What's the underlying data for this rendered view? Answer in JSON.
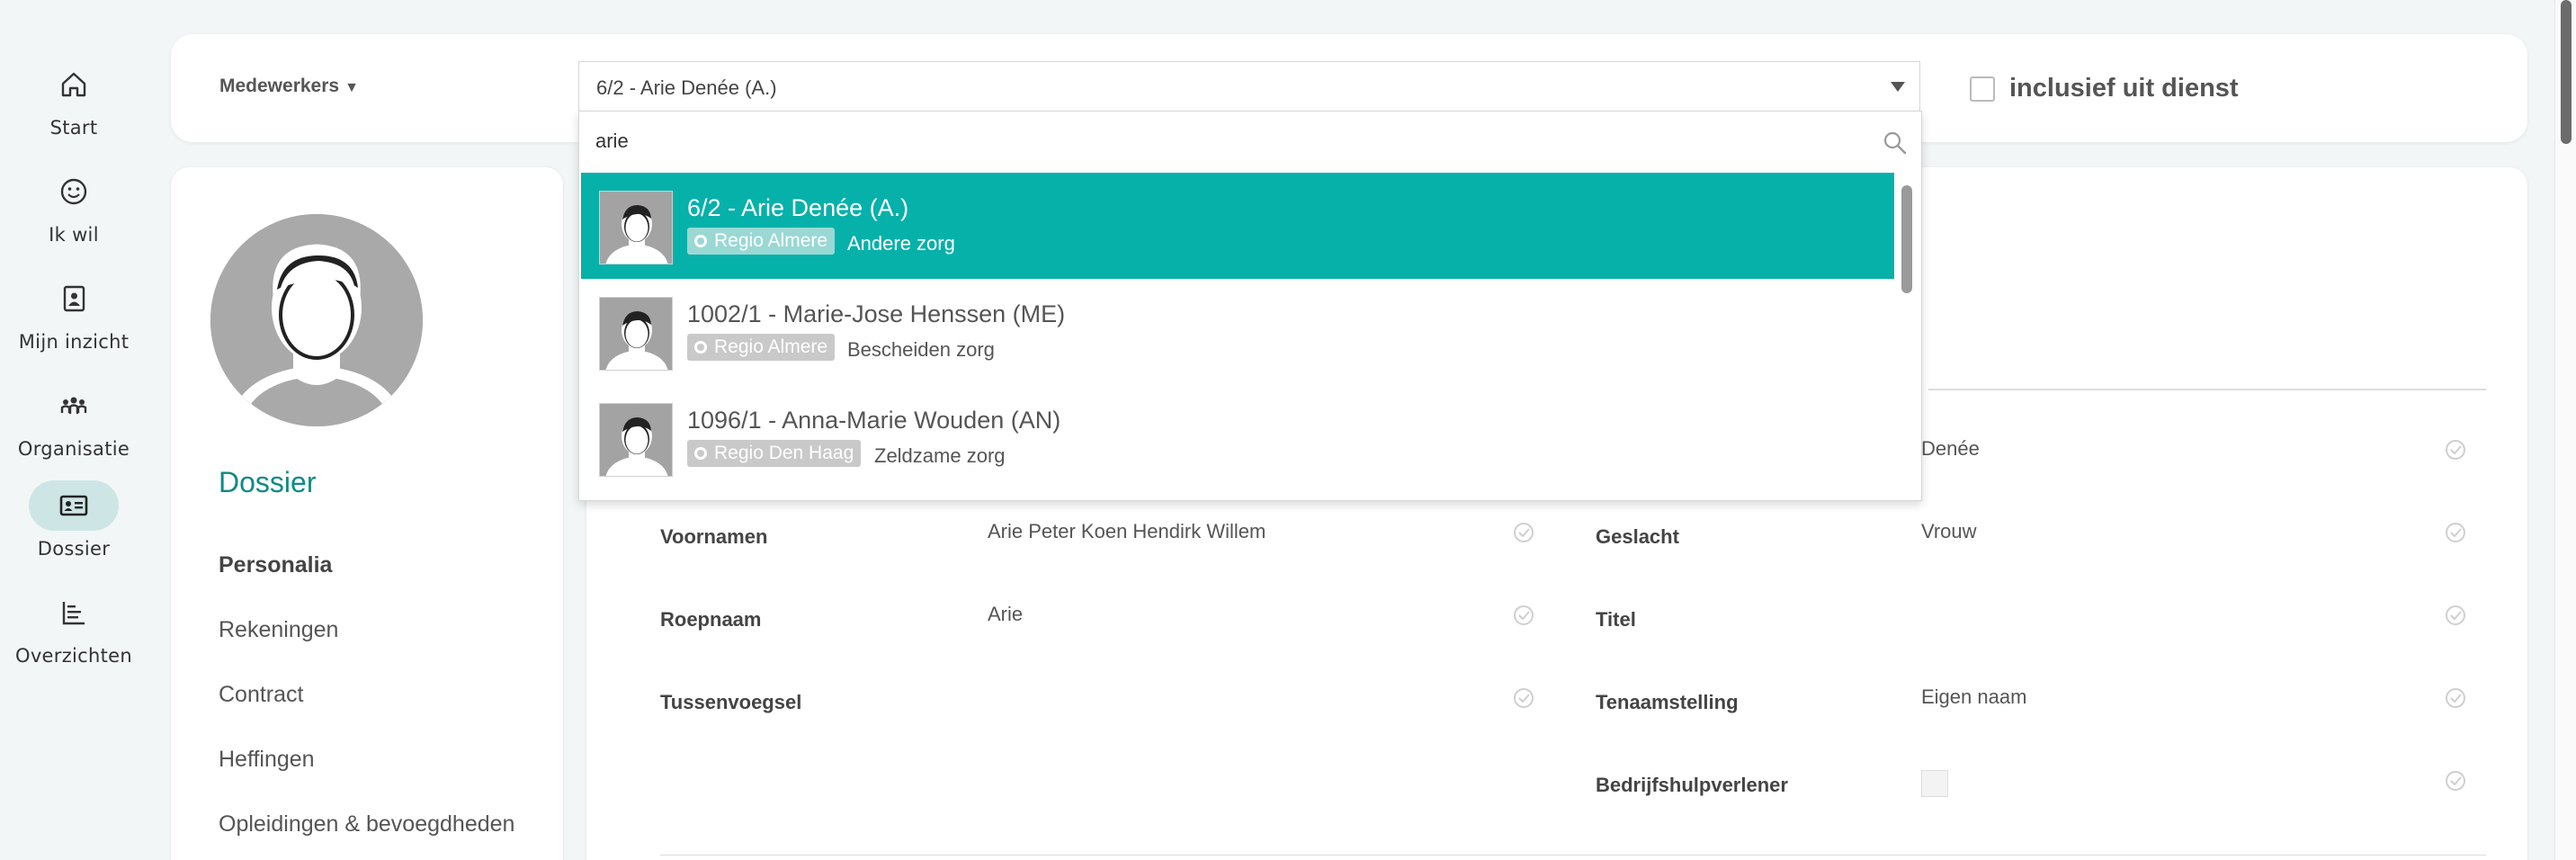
{
  "nav": {
    "items": [
      {
        "label": "Start",
        "icon": "home-icon"
      },
      {
        "label": "Ik wil",
        "icon": "smiley-icon"
      },
      {
        "label": "Mijn inzicht",
        "icon": "contact-book-icon"
      },
      {
        "label": "Organisatie",
        "icon": "people-group-icon"
      },
      {
        "label": "Dossier",
        "icon": "id-card-icon",
        "active": true
      },
      {
        "label": "Overzichten",
        "icon": "bar-chart-icon"
      }
    ]
  },
  "filter": {
    "label": "Medewerkers",
    "selected": "6/2 - Arie Denée (A.)",
    "include_label": "inclusief uit dienst"
  },
  "search": {
    "value": "arie"
  },
  "options": [
    {
      "name": "6/2 - Arie Denée (A.)",
      "region": "Regio Almere",
      "care": "Andere zorg",
      "selected": true
    },
    {
      "name": "1002/1 - Marie-Jose Henssen (ME)",
      "region": "Regio Almere",
      "care": "Bescheiden zorg"
    },
    {
      "name": "1096/1 - Anna-Marie Wouden (AN)",
      "region": "Regio Den Haag",
      "care": "Zeldzame zorg"
    }
  ],
  "profile": {
    "section_title": "Dossier",
    "menu": [
      "Personalia",
      "Rekeningen",
      "Contract",
      "Heffingen",
      "Opleidingen & bevoegdheden"
    ]
  },
  "fields": {
    "achternaam_value": "Denée",
    "voornamen_label": "Voornamen",
    "voornamen_value": "Arie Peter Koen Hendirk Willem",
    "roepnaam_label": "Roepnaam",
    "roepnaam_value": "Arie",
    "tussenvoegsel_label": "Tussenvoegsel",
    "geslacht_label": "Geslacht",
    "geslacht_value": "Vrouw",
    "titel_label": "Titel",
    "tenaamstelling_label": "Tenaamstelling",
    "tenaamstelling_value": "Eigen naam",
    "bhv_label": "Bedrijfshulpverlener"
  },
  "colors": {
    "accent": "#06b1aa",
    "nav_active_bg": "#cde6e5",
    "title_color": "#0f8a84"
  }
}
